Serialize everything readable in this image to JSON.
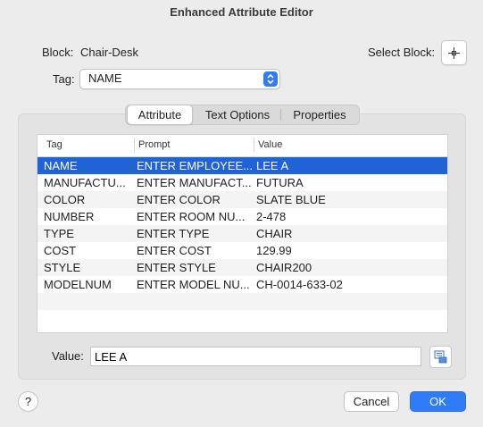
{
  "window": {
    "title": "Enhanced Attribute Editor"
  },
  "block": {
    "label": "Block:",
    "name": "Chair-Desk",
    "select_label": "Select Block:"
  },
  "tag": {
    "label": "Tag:",
    "selected": "NAME"
  },
  "tabs": [
    {
      "label": "Attribute",
      "active": true
    },
    {
      "label": "Text Options",
      "active": false
    },
    {
      "label": "Properties",
      "active": false
    }
  ],
  "table": {
    "columns": [
      "Tag",
      "Prompt",
      "Value"
    ],
    "rows": [
      {
        "tag": "NAME",
        "prompt": "ENTER EMPLOYEE...",
        "value": "LEE A",
        "selected": true
      },
      {
        "tag": "MANUFACTU...",
        "prompt": "ENTER MANUFACT...",
        "value": "FUTURA"
      },
      {
        "tag": "COLOR",
        "prompt": "ENTER COLOR",
        "value": "SLATE BLUE"
      },
      {
        "tag": "NUMBER",
        "prompt": "ENTER ROOM NU...",
        "value": "2-478"
      },
      {
        "tag": "TYPE",
        "prompt": "ENTER TYPE",
        "value": "CHAIR"
      },
      {
        "tag": "COST",
        "prompt": "ENTER COST",
        "value": "129.99"
      },
      {
        "tag": "STYLE",
        "prompt": "ENTER STYLE",
        "value": "CHAIR200"
      },
      {
        "tag": "MODELNUM",
        "prompt": "ENTER MODEL NU...",
        "value": "CH-0014-633-02"
      }
    ]
  },
  "value_field": {
    "label": "Value:",
    "value": "LEE A"
  },
  "buttons": {
    "help": "?",
    "cancel": "Cancel",
    "ok": "OK"
  },
  "colors": {
    "accent": "#2f7cf6",
    "selection": "#1f63d6"
  },
  "icons": {
    "select_block": "crosshair-icon",
    "tag_dropdown": "chevron-updown-icon",
    "field_editor": "field-editor-icon"
  }
}
